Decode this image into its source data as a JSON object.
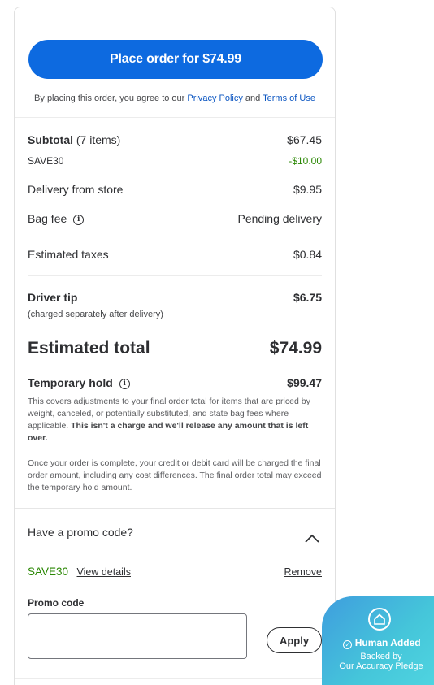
{
  "place_order": {
    "label": "Place order for $74.99"
  },
  "agreement": {
    "prefix": "By placing this order, you agree to our",
    "privacy": "Privacy Policy",
    "and": "and",
    "terms": "Terms of Use"
  },
  "summary": {
    "subtotal_label": "Subtotal",
    "subtotal_items": "(7 items)",
    "subtotal_value": "$67.45",
    "coupon_label": "SAVE30",
    "coupon_value": "-$10.00",
    "delivery_label": "Delivery from store",
    "delivery_value": "$9.95",
    "bag_label": "Bag fee",
    "bag_value": "Pending delivery",
    "tax_label": "Estimated taxes",
    "tax_value": "$0.84",
    "tip_label": "Driver tip",
    "tip_value": "$6.75",
    "tip_note": "(charged separately after delivery)",
    "total_label": "Estimated total",
    "total_value": "$74.99",
    "hold_label": "Temporary hold",
    "hold_value": "$99.47",
    "hold_para1": "This covers adjustments to your final order total for items that are priced by weight, canceled, or potentially substituted, and state bag fees where applicable.",
    "hold_para1_bold": "This isn't a charge and we'll release any amount that is left over.",
    "hold_para2": "Once your order is complete, your credit or debit card will be charged the final order amount, including any cost differences. The final order total may exceed the temporary hold amount."
  },
  "promo": {
    "question": "Have a promo code?",
    "applied_code": "SAVE30",
    "view_details": "View details",
    "remove": "Remove",
    "input_label": "Promo code",
    "input_value": "",
    "apply": "Apply"
  },
  "badge": {
    "line1": "Human Added",
    "line2": "Backed by",
    "line3": "Our Accuracy Pledge"
  },
  "colors": {
    "primary": "#0d6ae0",
    "green": "#2a8703",
    "badge": "#45c6da"
  }
}
